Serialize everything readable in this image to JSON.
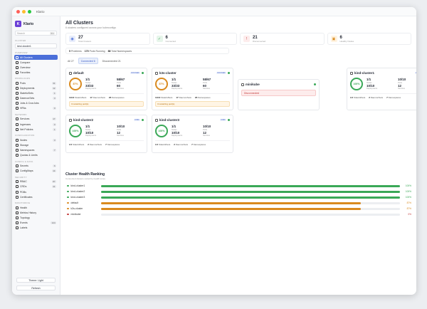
{
  "window": {
    "title": "Klario"
  },
  "sidebar": {
    "brand": "Klario",
    "search_placeholder": "Search",
    "search_kbd": "⌘K",
    "cluster_section": "CLUSTER",
    "cluster_value": "kind-cluster1",
    "sections": [
      {
        "title": "OVERVIEW",
        "items": [
          {
            "label": "All Clusters",
            "active": true,
            "count": ""
          },
          {
            "label": "Compare",
            "count": ""
          },
          {
            "label": "Overview",
            "count": ""
          },
          {
            "label": "Favorites",
            "count": ""
          }
        ]
      },
      {
        "title": "WORKLOADS",
        "items": [
          {
            "label": "Pods",
            "count": "31"
          },
          {
            "label": "Deployments",
            "count": "12"
          },
          {
            "label": "StatefulSets",
            "count": "1"
          },
          {
            "label": "DaemonSets",
            "count": "3"
          },
          {
            "label": "Jobs & CronJobs",
            "count": ""
          },
          {
            "label": "HPAs",
            "count": "0"
          }
        ]
      },
      {
        "title": "NETWORK",
        "items": [
          {
            "label": "Services",
            "count": "17"
          },
          {
            "label": "Ingresses",
            "count": "0"
          },
          {
            "label": "Net Policies",
            "count": "1"
          }
        ]
      },
      {
        "title": "CONFIGURATION",
        "items": [
          {
            "label": "Nodes",
            "count": "3"
          },
          {
            "label": "Storage",
            "count": ""
          },
          {
            "label": "Namespaces",
            "count": "7"
          },
          {
            "label": "Quotas & Limits",
            "count": ""
          }
        ]
      },
      {
        "title": "CONFIG & DATA",
        "items": [
          {
            "label": "Secrets",
            "count": "6"
          },
          {
            "label": "ConfigMaps",
            "count": "14"
          }
        ]
      },
      {
        "title": "SECURITY",
        "items": [
          {
            "label": "RBAC",
            "count": "87"
          },
          {
            "label": "CRDs",
            "count": "41"
          },
          {
            "label": "PDBs",
            "count": ""
          },
          {
            "label": "Certificates",
            "count": ""
          }
        ]
      },
      {
        "title": "MONITORING",
        "items": [
          {
            "label": "Health",
            "count": ""
          },
          {
            "label": "Metrics History",
            "count": ""
          },
          {
            "label": "Topology",
            "count": ""
          },
          {
            "label": "Events",
            "count": "124"
          },
          {
            "label": "Labels",
            "count": ""
          }
        ]
      }
    ],
    "theme_label": "Theme: Light",
    "refresh_label": "Refresh"
  },
  "header": {
    "title": "All Clusters",
    "subtitle": "6 clusters configured across your kubeconfigs"
  },
  "stats": [
    {
      "value": "27",
      "label": "Total Clusters",
      "color": "#e8edfb",
      "fg": "#4b6fd9",
      "icon": "cluster-icon",
      "glyph": "◉"
    },
    {
      "value": "6",
      "label": "Connected",
      "color": "#e6f5ea",
      "fg": "#3aa857",
      "icon": "check-icon",
      "glyph": "✓"
    },
    {
      "value": "21",
      "label": "Disconnected",
      "color": "#fdecec",
      "fg": "#c43c3c",
      "icon": "alert-icon",
      "glyph": "!"
    },
    {
      "value": "6",
      "label": "Healthy Nodes",
      "color": "#fff3e0",
      "fg": "#d98a1f",
      "icon": "node-icon",
      "glyph": "▣"
    }
  ],
  "chips": {
    "pods_val": "5",
    "pods_lbl": "Problems",
    "run_val": "175",
    "run_lbl": "Pods Running",
    "ns_val": "88",
    "ns_lbl": "Total Namespaces"
  },
  "filters": {
    "all": "All",
    "all_n": "27",
    "connected": "Connected",
    "connected_n": "6",
    "disconnected": "Disconnected",
    "disconnected_n": "21"
  },
  "cards": [
    {
      "name": "default",
      "tag": "DOCKER",
      "pct": "87%",
      "ring": "#d98a1f",
      "nodes": "1/1",
      "nodes_l": "Nodes",
      "pods": "58/67",
      "pods_l": "Pods",
      "dep": "33/33",
      "dep_l": "Deployments",
      "svc": "60",
      "svc_l": "Services",
      "f1": "11/13",
      "f1l": "StatefulSets",
      "f2": "17",
      "f2l": "DaemonSets",
      "f3": "26",
      "f3l": "Namespaces",
      "warn": "3 restarting pod(s)"
    },
    {
      "name": "k3s-cluster",
      "tag": "DOCKER",
      "pct": "87%",
      "ring": "#d98a1f",
      "nodes": "1/1",
      "nodes_l": "Nodes",
      "pods": "58/67",
      "pods_l": "Pods",
      "dep": "33/33",
      "dep_l": "Deployments",
      "svc": "60",
      "svc_l": "Services",
      "f1": "11/13",
      "f1l": "StatefulSets",
      "f2": "17",
      "f2l": "DaemonSets",
      "f3": "26",
      "f3l": "Namespaces",
      "warn": "3 restarting pod(s)"
    },
    {
      "name": "minikube",
      "error": "Disconnected"
    },
    {
      "name": "kind-cluster1",
      "tag": "KIND",
      "pct": "100%",
      "ring": "#3aa857",
      "nodes": "1/1",
      "nodes_l": "Nodes",
      "pods": "10/10",
      "pods_l": "Pods",
      "dep": "10/10",
      "dep_l": "Deployments",
      "svc": "12",
      "svc_l": "Services",
      "f1": "1/1",
      "f1l": "StatefulSets",
      "f2": "2",
      "f2l": "DaemonSets",
      "f3": "7",
      "f3l": "Namespaces"
    },
    {
      "name": "kind-cluster2",
      "tag": "KIND",
      "pct": "100%",
      "ring": "#3aa857",
      "nodes": "1/1",
      "nodes_l": "Nodes",
      "pods": "10/10",
      "pods_l": "Pods",
      "dep": "10/10",
      "dep_l": "Deployments",
      "svc": "12",
      "svc_l": "Services",
      "f1": "1/1",
      "f1l": "StatefulSets",
      "f2": "2",
      "f2l": "DaemonSets",
      "f3": "7",
      "f3l": "Namespaces"
    },
    {
      "name": "kind-cluster3",
      "tag": "KIND",
      "pct": "100%",
      "ring": "#3aa857",
      "nodes": "1/1",
      "nodes_l": "Nodes",
      "pods": "10/10",
      "pods_l": "Pods",
      "dep": "10/10",
      "dep_l": "Deployments",
      "svc": "12",
      "svc_l": "Services",
      "f1": "1/1",
      "f1l": "StatefulSets",
      "f2": "2",
      "f2l": "DaemonSets",
      "f3": "7",
      "f3l": "Namespaces"
    }
  ],
  "ranking": {
    "title": "Cluster Health Ranking",
    "subtitle": "Connected clusters sorted by health score",
    "rows": [
      {
        "name": "kind-cluster1",
        "pct": 100,
        "label": "100%",
        "color": "#3aa857"
      },
      {
        "name": "kind-cluster2",
        "pct": 100,
        "label": "100%",
        "color": "#3aa857"
      },
      {
        "name": "kind-cluster3",
        "pct": 100,
        "label": "100%",
        "color": "#3aa857"
      },
      {
        "name": "default",
        "pct": 87,
        "label": "87%",
        "color": "#d98a1f"
      },
      {
        "name": "k3s-cluster",
        "pct": 87,
        "label": "87%",
        "color": "#d98a1f"
      },
      {
        "name": "minikube",
        "pct": 0,
        "label": "0%",
        "color": "#c43c3c"
      }
    ]
  }
}
